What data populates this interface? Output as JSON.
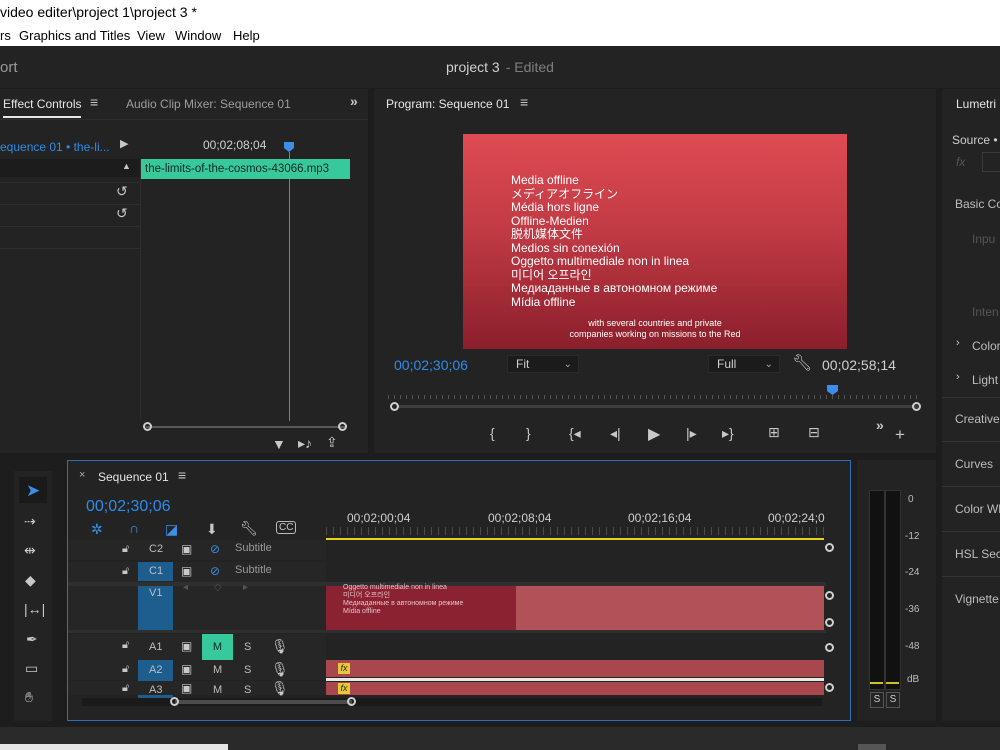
{
  "window": {
    "title": "video editer\\project 1\\project 3 *"
  },
  "menu": [
    "rs",
    "Graphics and Titles",
    "View",
    "Window",
    "Help"
  ],
  "header": {
    "left_text": "ort",
    "project_name": "project 3",
    "edited_label": "- Edited"
  },
  "effect_controls": {
    "tab_label": "Effect Controls",
    "other_tab": "Audio Clip Mixer: Sequence 01",
    "clip_ref": "equence 01 • the-li...",
    "timecode": "00;02;08;04",
    "clip_name": "the-limits-of-the-cosmos-43066.mp3"
  },
  "program_monitor": {
    "title": "Program: Sequence 01",
    "offline_lines": [
      "Media offline",
      "メディアオフライン",
      "Média hors ligne",
      "Offline-Medien",
      "脱机媒体文件",
      "Medios sin conexión",
      "Oggetto multimediale non in linea",
      "미디어 오프라인",
      "Медиаданные в автономном режиме",
      "Mídia offline"
    ],
    "caption_line1": "with several countries and private",
    "caption_line2": "companies working on missions to the Red",
    "current_time": "00;02;30;06",
    "fit_label": "Fit",
    "quality_label": "Full",
    "duration": "00;02;58;14"
  },
  "lumetri": {
    "tab_label": "Lumetri",
    "source_label": "Source •",
    "basic": "Basic Co",
    "input": "Inpu",
    "intensity": "Inten",
    "color": "Color",
    "light": "Light",
    "creative": "Creative",
    "curves": "Curves",
    "color_wheels": "Color Wh",
    "hsl": "HSL Seco",
    "vignette": "Vignette"
  },
  "timeline": {
    "tab_label": "Sequence 01",
    "timecode": "00;02;30;06",
    "ruler": [
      "00;02;00;04",
      "00;02;08;04",
      "00;02;16;04",
      "00;02;24;0"
    ],
    "tracks": [
      {
        "name": "C2",
        "label": "Subtitle"
      },
      {
        "name": "C1",
        "label": "Subtitle"
      },
      {
        "name": "V1"
      },
      {
        "name": "A1",
        "m": "M",
        "s": "S"
      },
      {
        "name": "A2",
        "m": "M",
        "s": "S"
      },
      {
        "name": "A3",
        "m": "M",
        "s": "S"
      }
    ],
    "v1_clip_lines": [
      "Oggetto multimediale non in linea",
      "미디어 오프라인",
      "Медиаданные в автономном режиме",
      "Mídia offline"
    ],
    "fx_label": "fx"
  },
  "meter": {
    "scale": [
      "0",
      "-12",
      "-24",
      "-36",
      "-48",
      "dB"
    ],
    "solo_l": "S",
    "solo_r": "S"
  },
  "colors": {
    "accent": "#2d8ceb",
    "clip_teal": "#37c89c",
    "clip_red": "#c65b5e",
    "playhead": "#3d8ee8"
  }
}
